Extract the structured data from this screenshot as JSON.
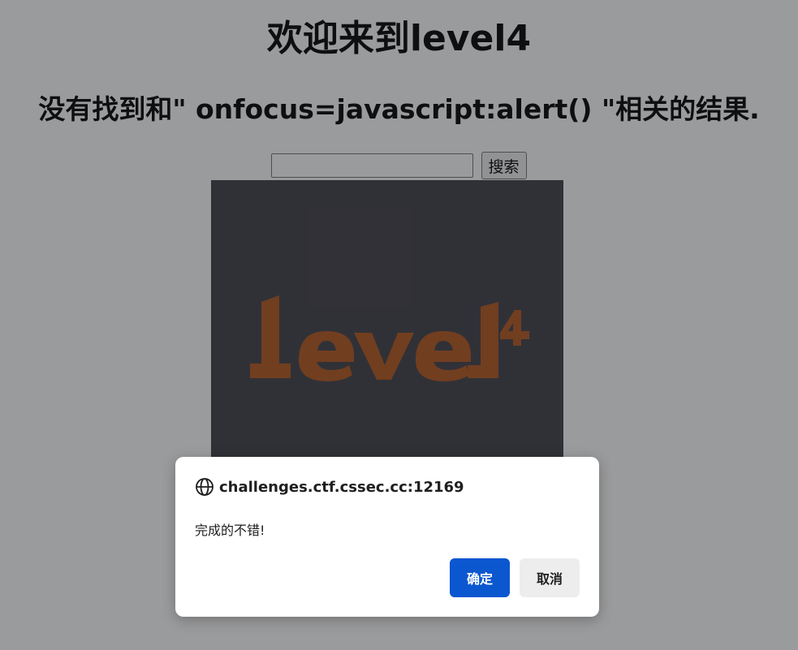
{
  "page": {
    "title": "欢迎来到level4",
    "result_message": "没有找到和\" onfocus=javascript:alert() \"相关的结果.",
    "search": {
      "value": "",
      "button_label": "搜索"
    },
    "banner": {
      "text": "level",
      "superscript": "4",
      "text_color": "#b5561e",
      "background_color": "#3f3e47"
    }
  },
  "dialog": {
    "origin": "challenges.ctf.cssec.cc:12169",
    "message": "完成的不错!",
    "ok_label": "确定",
    "cancel_label": "取消",
    "icon": "globe-icon",
    "ok_color": "#0b57d0"
  }
}
